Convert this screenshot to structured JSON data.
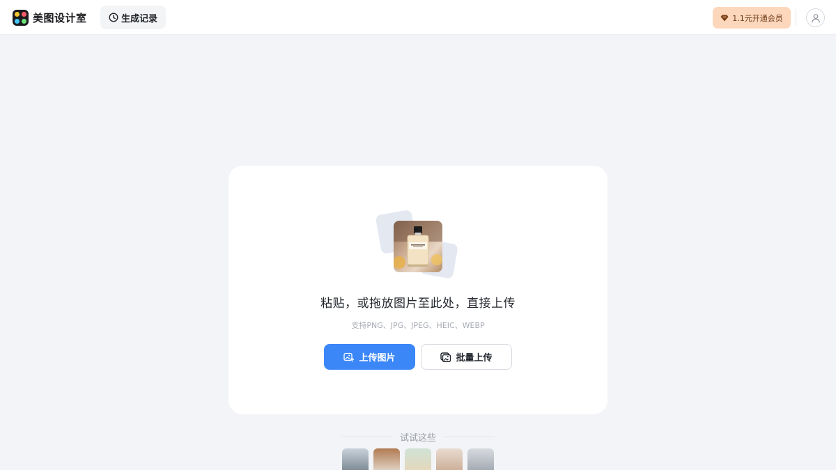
{
  "header": {
    "brand_name": "美图设计室",
    "history_label": "生成记录",
    "vip_label": "1.1元开通会员"
  },
  "upload": {
    "title": "粘贴，或拖放图片至此处，直接上传",
    "formats": "支持PNG、JPG、JPEG、HEIC、WEBP",
    "upload_button": "上传图片",
    "batch_button": "批量上传"
  },
  "samples": {
    "heading": "试试这些",
    "thumbnails": [
      {
        "name": "sample-bottle",
        "color_top": "#c9d2dc",
        "color_bottom": "#6f7d86"
      },
      {
        "name": "sample-bag",
        "color_top": "#b07b52",
        "color_bottom": "#e9e2da"
      },
      {
        "name": "sample-candle",
        "color_top": "#cfe3d6",
        "color_bottom": "#e8d4b6"
      },
      {
        "name": "sample-chair",
        "color_top": "#e9dcd1",
        "color_bottom": "#c7a68e"
      },
      {
        "name": "sample-sneaker",
        "color_top": "#d8dbe0",
        "color_bottom": "#9aa1aa"
      }
    ]
  },
  "colors": {
    "accent": "#3b87f7",
    "vip_bg": "#fdd7bc",
    "page_bg": "#f3f4f7"
  }
}
